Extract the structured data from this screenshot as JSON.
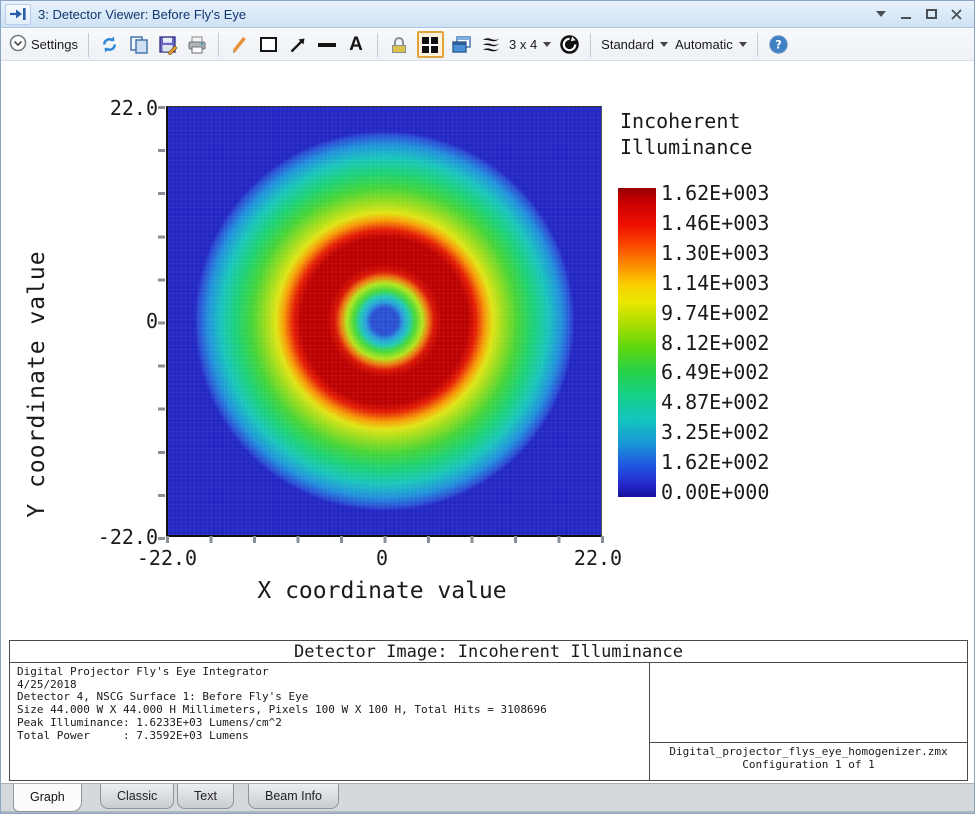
{
  "window": {
    "title": "3: Detector Viewer: Before Fly's Eye",
    "title_icon": "detector-viewer-icon",
    "control_icons": [
      "chevron-down-icon",
      "minimize-icon",
      "maximize-icon",
      "close-icon"
    ]
  },
  "toolbar": {
    "settings_label": "Settings",
    "grid_size_label": "3 x 4",
    "standard_label": "Standard",
    "automatic_label": "Automatic",
    "icon_names": [
      "settings-expander-icon",
      "refresh-icon",
      "copy-icon",
      "save-icon",
      "print-icon",
      "pencil-icon",
      "rectangle-icon",
      "arrow-icon",
      "line-icon",
      "text-icon",
      "lock-icon",
      "quad-view-icon",
      "cascade-windows-icon",
      "layers-icon",
      "clock-refresh-icon",
      "help-icon"
    ],
    "active_tool": "quad-view",
    "accent_color": "#e2a33c"
  },
  "plot": {
    "x_axis_label": "X coordinate value",
    "y_axis_label": "Y coordinate value",
    "x_tick_labels": [
      "-22.0",
      "0",
      "22.0"
    ],
    "y_tick_labels": [
      "22.0",
      "0",
      "-22.0"
    ],
    "legend_title_line1": "Incoherent",
    "legend_title_line2": "Illuminance",
    "colorbar_labels": [
      "1.62E+003",
      "1.46E+003",
      "1.30E+003",
      "1.14E+003",
      "9.74E+002",
      "8.12E+002",
      "6.49E+002",
      "4.87E+002",
      "3.25E+002",
      "1.62E+002",
      "0.00E+000"
    ]
  },
  "chart_data": {
    "type": "heatmap",
    "title": "Detector Image: Incoherent Illuminance",
    "xlabel": "X coordinate value",
    "ylabel": "Y coordinate value",
    "xlim": [
      -22.0,
      22.0
    ],
    "ylim": [
      -22.0,
      22.0
    ],
    "detector_size_mm": "44.000 W X 44.000 H",
    "grid_pixels": "100 W X 100 H",
    "units": "Lumens/cm^2",
    "colormap": "jet",
    "colorbar_scale": [
      1620,
      1460,
      1300,
      1140,
      974,
      812,
      649,
      487,
      325,
      162,
      0
    ],
    "peak_value": 1623.3,
    "total_power_lumens": 7359.2,
    "total_hits": 3108696,
    "pattern": "concentric-rings",
    "radial_profile": {
      "r_mm": [
        0,
        1.5,
        2.5,
        3.4,
        4.1,
        4.9,
        9.7,
        10.7,
        13.7,
        15.8,
        17.8,
        19.3,
        21,
        22
      ],
      "illuminance": [
        160,
        250,
        490,
        810,
        1140,
        1620,
        1620,
        1140,
        810,
        650,
        490,
        300,
        160,
        40
      ]
    }
  },
  "info_panel": {
    "header": "Detector Image: Incoherent Illuminance",
    "lines": [
      "Digital Projector Fly's Eye Integrator",
      "4/25/2018",
      "Detector 4, NSCG Surface 1: Before Fly's Eye",
      "Size 44.000 W X 44.000 H Millimeters, Pixels 100 W X 100 H, Total Hits = 3108696",
      "Peak Illuminance: 1.6233E+03 Lumens/cm^2",
      "Total Power     : 7.3592E+03 Lumens"
    ],
    "config_file": "Digital_projector_flys_eye_homogenizer.zmx",
    "config_line": "Configuration 1 of 1"
  },
  "tabs": [
    {
      "label": "Graph",
      "active": true
    },
    {
      "label": "Classic",
      "active": false
    },
    {
      "label": "Text",
      "active": false
    },
    {
      "label": "Beam Info",
      "active": false
    }
  ]
}
